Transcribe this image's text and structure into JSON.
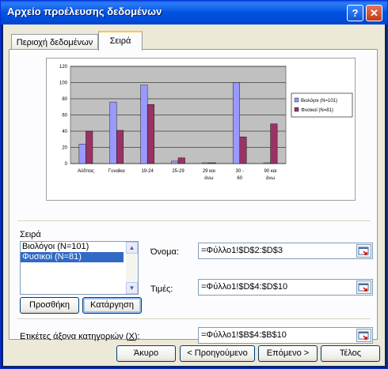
{
  "window": {
    "title": "Αρχείο προέλευσης δεδομένων",
    "help_glyph": "?",
    "close_glyph": "✕"
  },
  "tabs": [
    {
      "label": "Περιοχή δεδομένων"
    },
    {
      "label": "Σειρά"
    }
  ],
  "chart_data": {
    "type": "bar",
    "categories": [
      "Αϋδπας",
      "Γυναίκα",
      "19-24",
      "25-29",
      "29 και άνω",
      "30 - 60",
      "90 και άνω"
    ],
    "series": [
      {
        "name": "Βιολόγοι (N=101)",
        "values": [
          24,
          76,
          97,
          3,
          1,
          100,
          1
        ],
        "color": "#9999ff"
      },
      {
        "name": "Φυσικοί (N=81)",
        "values": [
          40,
          41,
          73,
          7,
          1,
          33,
          49
        ],
        "color": "#993366"
      }
    ],
    "ylim": [
      0,
      120
    ],
    "yticks": [
      "0",
      "20",
      "40",
      "60",
      "80",
      "100",
      "120"
    ],
    "grid": true,
    "legend": "right",
    "plot_bg": "#c0c0c0"
  },
  "series_section": {
    "label": "Σειρά",
    "items": [
      "Βιολόγοι (N=101)",
      "Φυσικοί (N=81)"
    ],
    "selected_index": 1,
    "add_label": "Προσθήκη",
    "remove_label": "Κατάργηση"
  },
  "fields": {
    "name_label": "Όνομα:",
    "name_value": "=Φύλλο1!$D$2:$D$3",
    "values_label": "Τιμές:",
    "values_value": "=Φύλλο1!$D$4:$D$10",
    "category_label_pre": "Ετικέτες άξονα κατηγοριών (",
    "category_label_key": "X",
    "category_label_post": "):",
    "category_value": "=Φύλλο1!$B$4:$B$10"
  },
  "footer": {
    "cancel": "Άκυρο",
    "back": "< Προηγούμενο",
    "next": "Επόμενο >",
    "finish": "Τέλος"
  }
}
